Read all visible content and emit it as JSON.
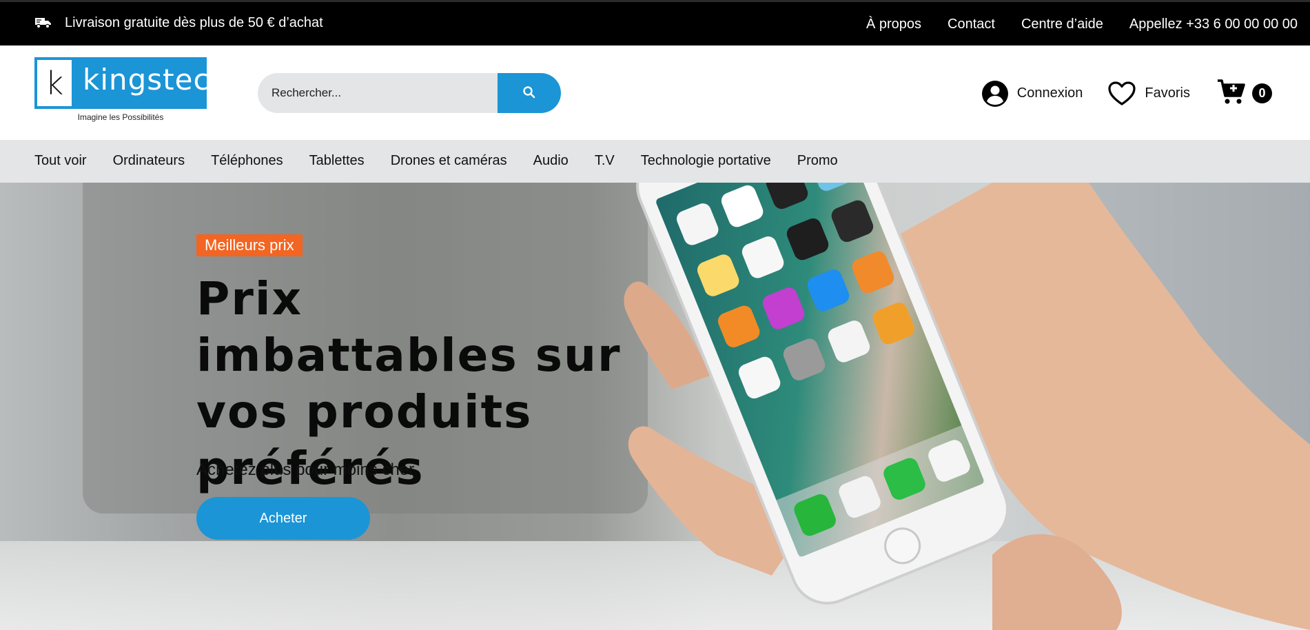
{
  "topbar": {
    "shipping_text": "Livraison gratuite dès plus de 50 € d’achat",
    "shipping_icon": "truck-icon",
    "links": [
      "À propos",
      "Contact",
      "Centre d’aide",
      "Appellez +33 6 00 00 00 00"
    ]
  },
  "header": {
    "logo": {
      "letter": "k",
      "name": "kingstech",
      "tagline": "Imagine les Possibilités"
    },
    "search": {
      "placeholder": "Rechercher...",
      "value": "",
      "icon": "search-icon"
    },
    "account": {
      "label": "Connexion",
      "icon": "user-circle-icon"
    },
    "favorites": {
      "label": "Favoris",
      "icon": "heart-icon"
    },
    "cart": {
      "count": "0",
      "icon": "cart-plus-icon"
    }
  },
  "nav": {
    "items": [
      "Tout voir",
      "Ordinateurs",
      "Téléphones",
      "Tablettes",
      "Drones et caméras",
      "Audio",
      "T.V",
      "Technologie portative",
      "Promo"
    ]
  },
  "hero": {
    "badge": "Meilleurs prix",
    "title": "Prix imbattables sur vos produits préférés",
    "subtitle": "Achetez plus pour moins cher",
    "cta": "Acheter",
    "image": "hand-holding-smartphone"
  },
  "colors": {
    "accent": "#1b95d6",
    "badge": "#f26522",
    "topbar": "#000000",
    "nav": "#e3e5e6"
  }
}
